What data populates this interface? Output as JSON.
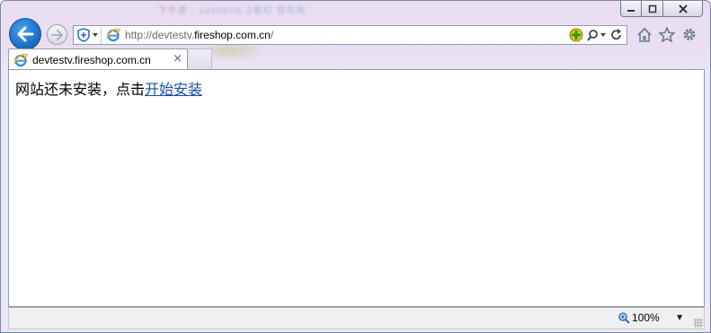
{
  "window": {
    "title_blurred": "下午茶 - ",
    "title_blurred_accent": "szshello 2看幻 音乐库"
  },
  "nav": {
    "address_prefix": "http://devtestv.",
    "address_host": "fireshop.com.cn",
    "address_suffix": "/"
  },
  "tab": {
    "title": "devtestv.fireshop.com.cn",
    "close_glyph": "×"
  },
  "page": {
    "message": "网站还未安装，点击",
    "link": "开始安装"
  },
  "status": {
    "zoom": "100%"
  },
  "colors": {
    "accent_blue": "#1c6fc9",
    "link": "#1a4ea3"
  }
}
